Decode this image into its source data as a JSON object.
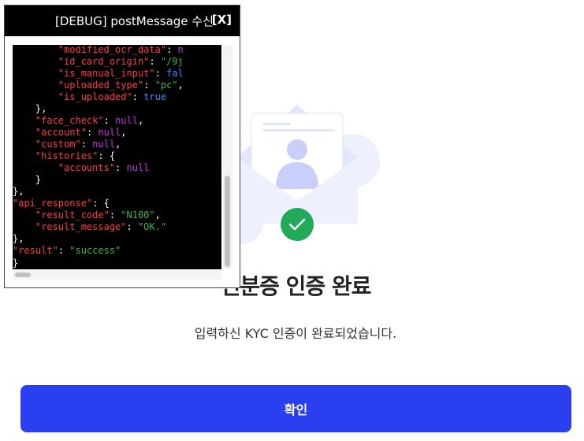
{
  "page": {
    "title": "신분증 인증 완료",
    "subtitle": "입력하신 KYC 인증이 완료되었습니다.",
    "confirm_label": "확인"
  },
  "debug": {
    "title": "[DEBUG] postMessage 수신",
    "close_label": "[X]",
    "code_lines": [
      [
        [
          "        ",
          ""
        ],
        [
          "\"modified_ocr_data\"",
          "k"
        ],
        [
          ": ",
          ""
        ],
        [
          "n",
          "n"
        ]
      ],
      [
        [
          "        ",
          ""
        ],
        [
          "\"id_card_origin\"",
          "k"
        ],
        [
          ": ",
          ""
        ],
        [
          "\"/9j",
          "s"
        ]
      ],
      [
        [
          "        ",
          ""
        ],
        [
          "\"is_manual_input\"",
          "k"
        ],
        [
          ": ",
          ""
        ],
        [
          "fal",
          "b"
        ]
      ],
      [
        [
          "        ",
          ""
        ],
        [
          "\"uploaded_type\"",
          "k"
        ],
        [
          ": ",
          ""
        ],
        [
          "\"pc\"",
          "s"
        ],
        [
          ",",
          ""
        ]
      ],
      [
        [
          "        ",
          ""
        ],
        [
          "\"is_uploaded\"",
          "k"
        ],
        [
          ": ",
          ""
        ],
        [
          "true",
          "b"
        ]
      ],
      [
        [
          "    },",
          ""
        ]
      ],
      [
        [
          "    ",
          ""
        ],
        [
          "\"face_check\"",
          "k"
        ],
        [
          ": ",
          ""
        ],
        [
          "null",
          "n"
        ],
        [
          ",",
          ""
        ]
      ],
      [
        [
          "    ",
          ""
        ],
        [
          "\"account\"",
          "k"
        ],
        [
          ": ",
          ""
        ],
        [
          "null",
          "n"
        ],
        [
          ",",
          ""
        ]
      ],
      [
        [
          "    ",
          ""
        ],
        [
          "\"custom\"",
          "k"
        ],
        [
          ": ",
          ""
        ],
        [
          "null",
          "n"
        ],
        [
          ",",
          ""
        ]
      ],
      [
        [
          "    ",
          ""
        ],
        [
          "\"histories\"",
          "k"
        ],
        [
          ": {",
          ""
        ]
      ],
      [
        [
          "        ",
          ""
        ],
        [
          "\"accounts\"",
          "k"
        ],
        [
          ": ",
          ""
        ],
        [
          "null",
          "n"
        ]
      ],
      [
        [
          "    }",
          ""
        ]
      ],
      [
        [
          "},",
          ""
        ]
      ],
      [
        [
          "",
          ""
        ],
        [
          "\"api_response\"",
          "k"
        ],
        [
          ": {",
          ""
        ]
      ],
      [
        [
          "    ",
          ""
        ],
        [
          "\"result_code\"",
          "k"
        ],
        [
          ": ",
          ""
        ],
        [
          "\"N100\"",
          "s"
        ],
        [
          ",",
          ""
        ]
      ],
      [
        [
          "    ",
          ""
        ],
        [
          "\"result_message\"",
          "k"
        ],
        [
          ": ",
          ""
        ],
        [
          "\"OK.\"",
          "s"
        ]
      ],
      [
        [
          "},",
          ""
        ]
      ],
      [
        [
          "",
          ""
        ],
        [
          "\"result\"",
          "k"
        ],
        [
          ": ",
          ""
        ],
        [
          "\"success\"",
          "s"
        ]
      ]
    ],
    "last_line": "}"
  },
  "colors": {
    "primary": "#2a3ff0",
    "illustration_light": "#eef0fd",
    "illustration_mid": "#c9cffa",
    "check_green": "#22a95a"
  },
  "icons": {
    "illustration": "envelope-id-card-icon",
    "check": "check-circle-icon"
  }
}
